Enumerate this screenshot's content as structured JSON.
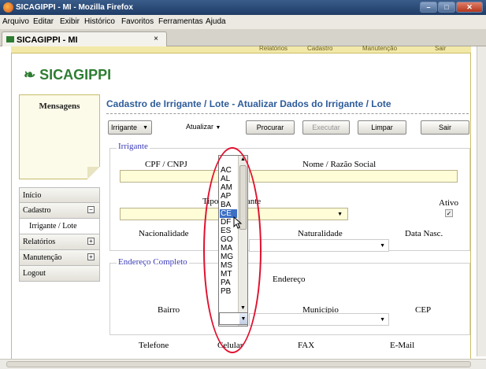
{
  "window": {
    "title": "SICAGIPPI - MI - Mozilla Firefox"
  },
  "menubar": [
    "Arquivo",
    "Editar",
    "Exibir",
    "Histórico",
    "Favoritos",
    "Ferramentas",
    "Ajuda"
  ],
  "tab": {
    "label": "SICAGIPPI - MI",
    "close": "×"
  },
  "topnav": [
    "Relatórios",
    "Cadastro",
    "Manutenção",
    "Sair"
  ],
  "logo": {
    "text": "SICAGIPPI"
  },
  "messages": {
    "title": "Mensagens"
  },
  "sidebar": {
    "items": [
      {
        "label": "Início",
        "toggle": ""
      },
      {
        "label": "Cadastro",
        "toggle": "−"
      },
      {
        "label": "Irrigante / Lote",
        "toggle": ""
      },
      {
        "label": "Relatórios",
        "toggle": "+"
      },
      {
        "label": "Manutenção",
        "toggle": "+"
      },
      {
        "label": "Logout",
        "toggle": ""
      }
    ]
  },
  "form": {
    "title": "Cadastro de Irrigante / Lote - Atualizar Dados do Irrigante / Lote",
    "type_select": "Irrigante",
    "action_select": "Atualizar",
    "buttons": {
      "procurar": "Procurar",
      "executar": "Executar",
      "limpar": "Limpar",
      "sair": "Sair"
    },
    "irrigante": {
      "legend": "Irrigante",
      "cpf_label": "CPF / CNPJ",
      "nome_label": "Nome / Razão Social",
      "tipo_label": "Tipo de Irrigante",
      "ativo_label": "Ativo",
      "ativo_check": "✓",
      "nacionalidade_label": "Nacionalidade",
      "naturalidade_label": "Naturalidade",
      "data_nasc_label": "Data Nasc."
    },
    "endereco": {
      "legend": "Endereço Completo",
      "endereco_label": "Endereço",
      "bairro_label": "Bairro",
      "municipio_label": "Município",
      "cep_label": "CEP",
      "telefone_label": "Telefone",
      "celular_label": "Celular",
      "fax_label": "FAX",
      "email_label": "E-Mail"
    }
  },
  "uf_dropdown": {
    "options": [
      "AC",
      "AL",
      "AM",
      "AP",
      "BA",
      "CE",
      "DF",
      "ES",
      "GO",
      "MA",
      "MG",
      "MS",
      "MT",
      "PA",
      "PB"
    ],
    "selected": "CE"
  }
}
